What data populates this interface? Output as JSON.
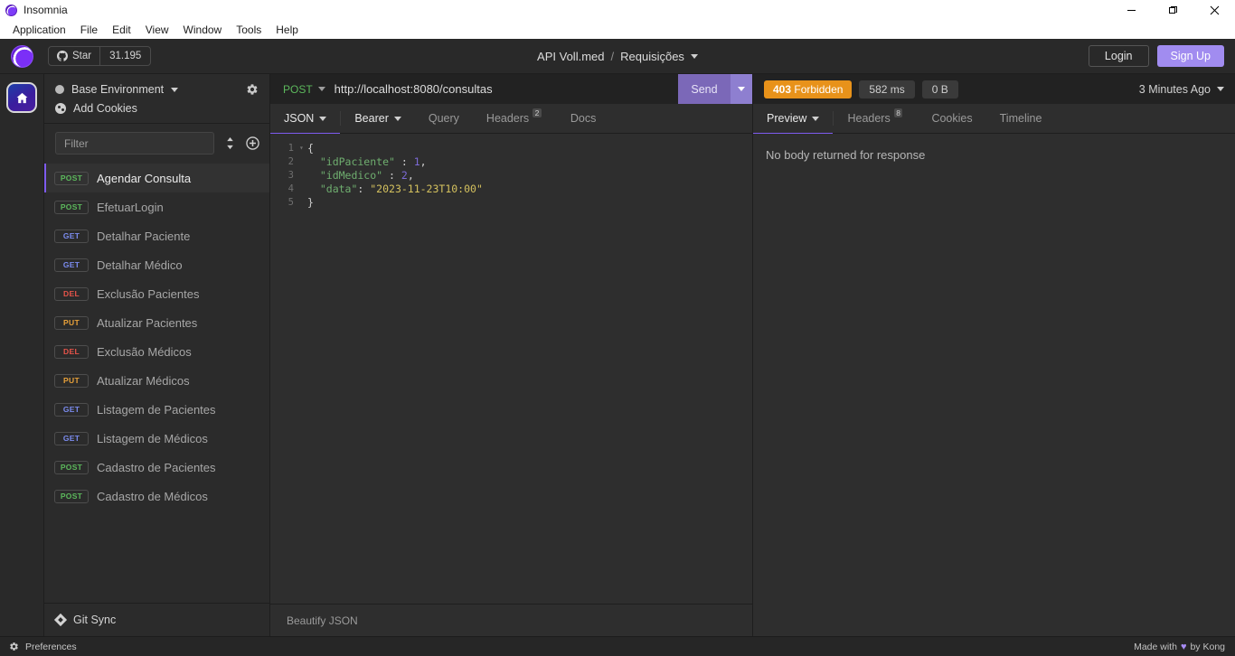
{
  "window": {
    "title": "Insomnia",
    "controls": {
      "minimize": "minimize-icon",
      "maximize": "maximize-icon",
      "close": "close-icon"
    }
  },
  "menubar": [
    "Application",
    "File",
    "Edit",
    "View",
    "Window",
    "Tools",
    "Help"
  ],
  "header": {
    "star_label": "Star",
    "star_count": "31.195",
    "breadcrumb_workspace": "API Voll.med",
    "breadcrumb_sep": "/",
    "breadcrumb_page": "Requisições",
    "login_label": "Login",
    "signup_label": "Sign Up"
  },
  "sidebar": {
    "environment": "Base Environment",
    "cookies": "Add Cookies",
    "filter_placeholder": "Filter",
    "git_sync": "Git Sync",
    "requests": [
      {
        "method": "POST",
        "name": "Agendar Consulta",
        "active": true
      },
      {
        "method": "POST",
        "name": "EfetuarLogin",
        "active": false
      },
      {
        "method": "GET",
        "name": "Detalhar Paciente",
        "active": false
      },
      {
        "method": "GET",
        "name": "Detalhar Médico",
        "active": false
      },
      {
        "method": "DEL",
        "name": "Exclusão Pacientes",
        "active": false
      },
      {
        "method": "PUT",
        "name": "Atualizar Pacientes",
        "active": false
      },
      {
        "method": "DEL",
        "name": "Exclusão Médicos",
        "active": false
      },
      {
        "method": "PUT",
        "name": "Atualizar Médicos",
        "active": false
      },
      {
        "method": "GET",
        "name": "Listagem de Pacientes",
        "active": false
      },
      {
        "method": "GET",
        "name": "Listagem de Médicos",
        "active": false
      },
      {
        "method": "POST",
        "name": "Cadastro de Pacientes",
        "active": false
      },
      {
        "method": "POST",
        "name": "Cadastro de Médicos",
        "active": false
      }
    ]
  },
  "request": {
    "method": "POST",
    "url": "http://localhost:8080/consultas",
    "send_label": "Send",
    "tabs": [
      {
        "label": "JSON",
        "badge": "",
        "selected": true,
        "caret": true
      },
      {
        "label": "Bearer",
        "badge": "",
        "selected": true,
        "caret": true
      },
      {
        "label": "Query",
        "badge": "",
        "selected": false,
        "caret": false
      },
      {
        "label": "Headers",
        "badge": "2",
        "selected": false,
        "caret": false
      },
      {
        "label": "Docs",
        "badge": "",
        "selected": false,
        "caret": false
      }
    ],
    "body_lines": [
      {
        "n": "1",
        "fold": true,
        "tokens": [
          {
            "t": "{",
            "c": "j-punc"
          }
        ]
      },
      {
        "n": "2",
        "fold": false,
        "tokens": [
          {
            "t": "  \"idPaciente\"",
            "c": "j-key"
          },
          {
            "t": " : ",
            "c": "j-punc"
          },
          {
            "t": "1",
            "c": "j-num"
          },
          {
            "t": ",",
            "c": "j-punc"
          }
        ]
      },
      {
        "n": "3",
        "fold": false,
        "tokens": [
          {
            "t": "  \"idMedico\"",
            "c": "j-key"
          },
          {
            "t": " : ",
            "c": "j-punc"
          },
          {
            "t": "2",
            "c": "j-num"
          },
          {
            "t": ",",
            "c": "j-punc"
          }
        ]
      },
      {
        "n": "4",
        "fold": false,
        "tokens": [
          {
            "t": "  \"data\"",
            "c": "j-key"
          },
          {
            "t": ": ",
            "c": "j-punc"
          },
          {
            "t": "\"2023-11-23T10:00\"",
            "c": "j-str"
          }
        ]
      },
      {
        "n": "5",
        "fold": false,
        "tokens": [
          {
            "t": "}",
            "c": "j-punc"
          }
        ]
      }
    ],
    "beautify_label": "Beautify JSON"
  },
  "response": {
    "status_code": "403",
    "status_text": "Forbidden",
    "time": "582 ms",
    "size": "0 B",
    "timestamp": "3 Minutes Ago",
    "tabs": [
      {
        "label": "Preview",
        "badge": "",
        "selected": true,
        "caret": true
      },
      {
        "label": "Headers",
        "badge": "8",
        "selected": false,
        "caret": false
      },
      {
        "label": "Cookies",
        "badge": "",
        "selected": false,
        "caret": false
      },
      {
        "label": "Timeline",
        "badge": "",
        "selected": false,
        "caret": false
      }
    ],
    "body_message": "No body returned for response"
  },
  "footer": {
    "preferences": "Preferences",
    "made_with_prefix": "Made with",
    "heart": "♥",
    "made_with_suffix": "by Kong"
  }
}
